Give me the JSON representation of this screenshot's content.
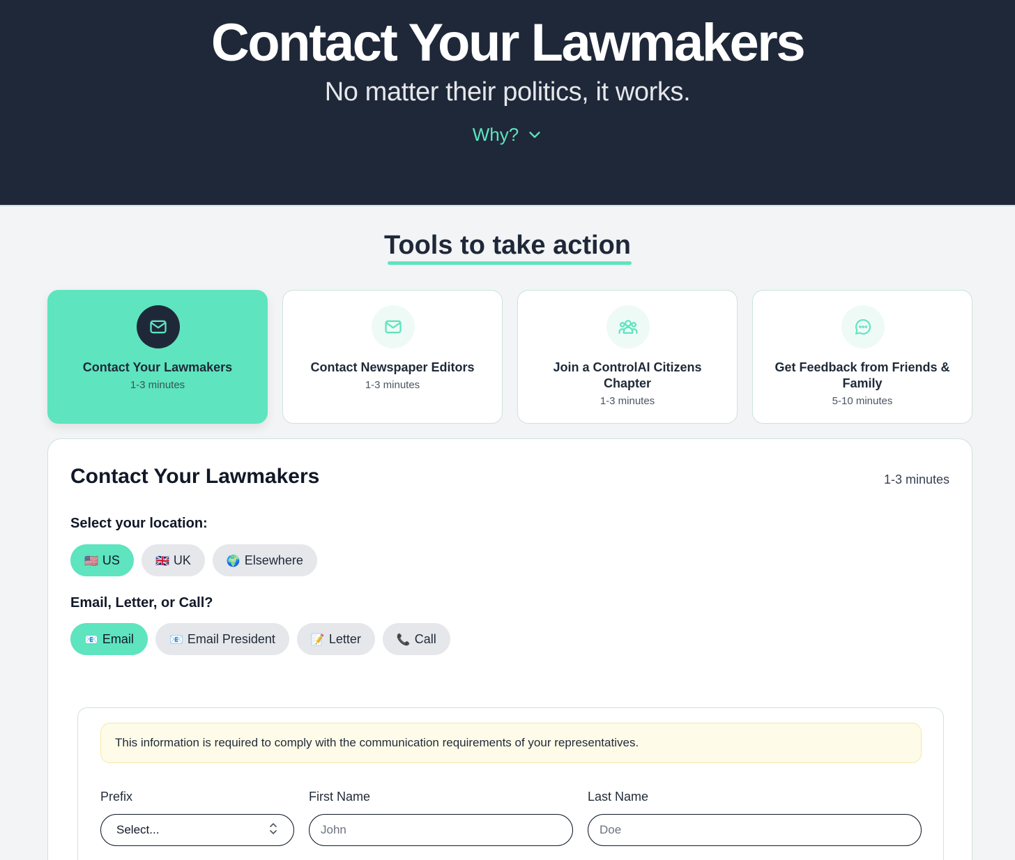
{
  "hero": {
    "title": "Contact Your Lawmakers",
    "subtitle": "No matter their politics, it works.",
    "why_label": "Why?"
  },
  "tools": {
    "section_title": "Tools to take action",
    "cards": [
      {
        "name": "Contact Your Lawmakers",
        "time": "1-3 minutes",
        "icon": "mail-icon",
        "active": true
      },
      {
        "name": "Contact Newspaper Editors",
        "time": "1-3 minutes",
        "icon": "mail-icon",
        "active": false
      },
      {
        "name": "Join a ControlAI Citizens Chapter",
        "time": "1-3 minutes",
        "icon": "group-icon",
        "active": false
      },
      {
        "name": "Get Feedback from Friends & Family",
        "time": "5-10 minutes",
        "icon": "chat-bubble-icon",
        "active": false
      }
    ]
  },
  "panel": {
    "title": "Contact Your Lawmakers",
    "time": "1-3 minutes",
    "location_label": "Select your location:",
    "locations": [
      {
        "emoji": "🇺🇸",
        "label": "US",
        "active": true
      },
      {
        "emoji": "🇬🇧",
        "label": "UK",
        "active": false
      },
      {
        "emoji": "🌍",
        "label": "Elsewhere",
        "active": false
      }
    ],
    "method_label": "Email, Letter, or Call?",
    "methods": [
      {
        "emoji": "📧",
        "label": "Email",
        "active": true
      },
      {
        "emoji": "📧",
        "label": "Email President",
        "active": false
      },
      {
        "emoji": "📝",
        "label": "Letter",
        "active": false
      },
      {
        "emoji": "📞",
        "label": "Call",
        "active": false
      }
    ]
  },
  "form": {
    "notice": "This information is required to comply with the communication requirements of your representatives.",
    "prefix_label": "Prefix",
    "prefix_value": "Select...",
    "first_name_label": "First Name",
    "first_name_placeholder": "John",
    "last_name_label": "Last Name",
    "last_name_placeholder": "Doe"
  },
  "colors": {
    "accent": "#5ee4bf",
    "hero_bg": "#1f2839",
    "page_bg": "#f2f4f5"
  }
}
